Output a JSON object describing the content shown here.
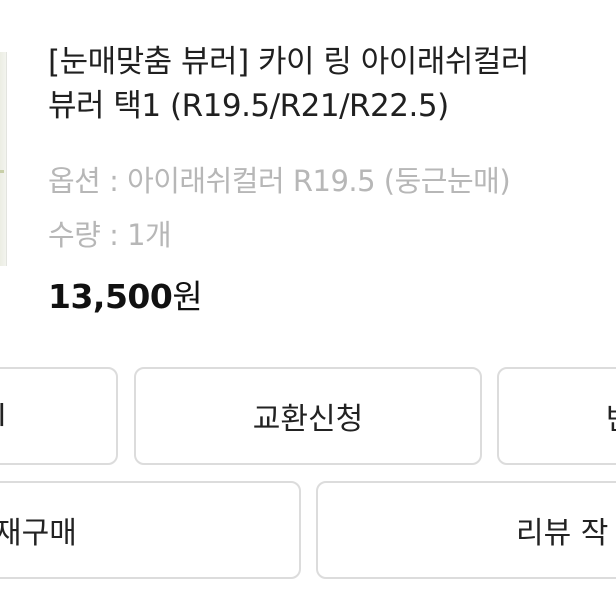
{
  "product": {
    "title_line1": "[눈매맞춤 뷰러] 카이 링 아이래쉬컬러",
    "title_line2": "뷰러 택1 (R19.5/R21/R22.5)",
    "option": "옵션 : 아이래쉬컬러 R19.5 (둥근눈매)",
    "quantity": "수량 : 1개",
    "price_number": "13,500",
    "price_unit": "원"
  },
  "actions": {
    "row1": [
      "l",
      "교환신청",
      "반"
    ],
    "row2": [
      "재구매",
      "리뷰 작"
    ]
  },
  "colors": {
    "text": "#202020",
    "muted": "#b7b7b7",
    "border": "#dcdcdc"
  }
}
